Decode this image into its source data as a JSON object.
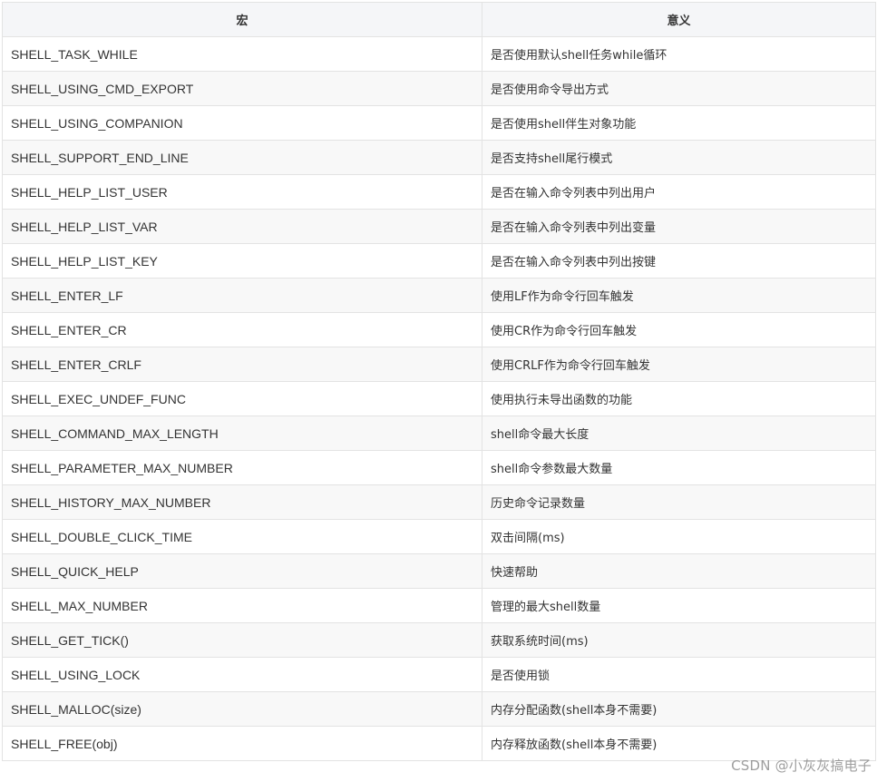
{
  "table": {
    "headers": {
      "macro": "宏",
      "meaning": "意义"
    },
    "rows": [
      {
        "macro": "SHELL_TASK_WHILE",
        "meaning": "是否使用默认shell任务while循环"
      },
      {
        "macro": "SHELL_USING_CMD_EXPORT",
        "meaning": "是否使用命令导出方式"
      },
      {
        "macro": "SHELL_USING_COMPANION",
        "meaning": "是否使用shell伴生对象功能"
      },
      {
        "macro": "SHELL_SUPPORT_END_LINE",
        "meaning": "是否支持shell尾行模式"
      },
      {
        "macro": "SHELL_HELP_LIST_USER",
        "meaning": "是否在输入命令列表中列出用户"
      },
      {
        "macro": "SHELL_HELP_LIST_VAR",
        "meaning": "是否在输入命令列表中列出变量"
      },
      {
        "macro": "SHELL_HELP_LIST_KEY",
        "meaning": "是否在输入命令列表中列出按键"
      },
      {
        "macro": "SHELL_ENTER_LF",
        "meaning": "使用LF作为命令行回车触发"
      },
      {
        "macro": "SHELL_ENTER_CR",
        "meaning": "使用CR作为命令行回车触发"
      },
      {
        "macro": "SHELL_ENTER_CRLF",
        "meaning": "使用CRLF作为命令行回车触发"
      },
      {
        "macro": "SHELL_EXEC_UNDEF_FUNC",
        "meaning": "使用执行未导出函数的功能"
      },
      {
        "macro": "SHELL_COMMAND_MAX_LENGTH",
        "meaning": "shell命令最大长度"
      },
      {
        "macro": "SHELL_PARAMETER_MAX_NUMBER",
        "meaning": "shell命令参数最大数量"
      },
      {
        "macro": "SHELL_HISTORY_MAX_NUMBER",
        "meaning": "历史命令记录数量"
      },
      {
        "macro": "SHELL_DOUBLE_CLICK_TIME",
        "meaning": "双击间隔(ms)"
      },
      {
        "macro": "SHELL_QUICK_HELP",
        "meaning": "快速帮助"
      },
      {
        "macro": "SHELL_MAX_NUMBER",
        "meaning": "管理的最大shell数量"
      },
      {
        "macro": "SHELL_GET_TICK()",
        "meaning": "获取系统时间(ms)"
      },
      {
        "macro": "SHELL_USING_LOCK",
        "meaning": "是否使用锁"
      },
      {
        "macro": "SHELL_MALLOC(size)",
        "meaning": "内存分配函数(shell本身不需要)"
      },
      {
        "macro": "SHELL_FREE(obj)",
        "meaning": "内存释放函数(shell本身不需要)"
      }
    ]
  },
  "watermark": "CSDN @小灰灰搞电子"
}
